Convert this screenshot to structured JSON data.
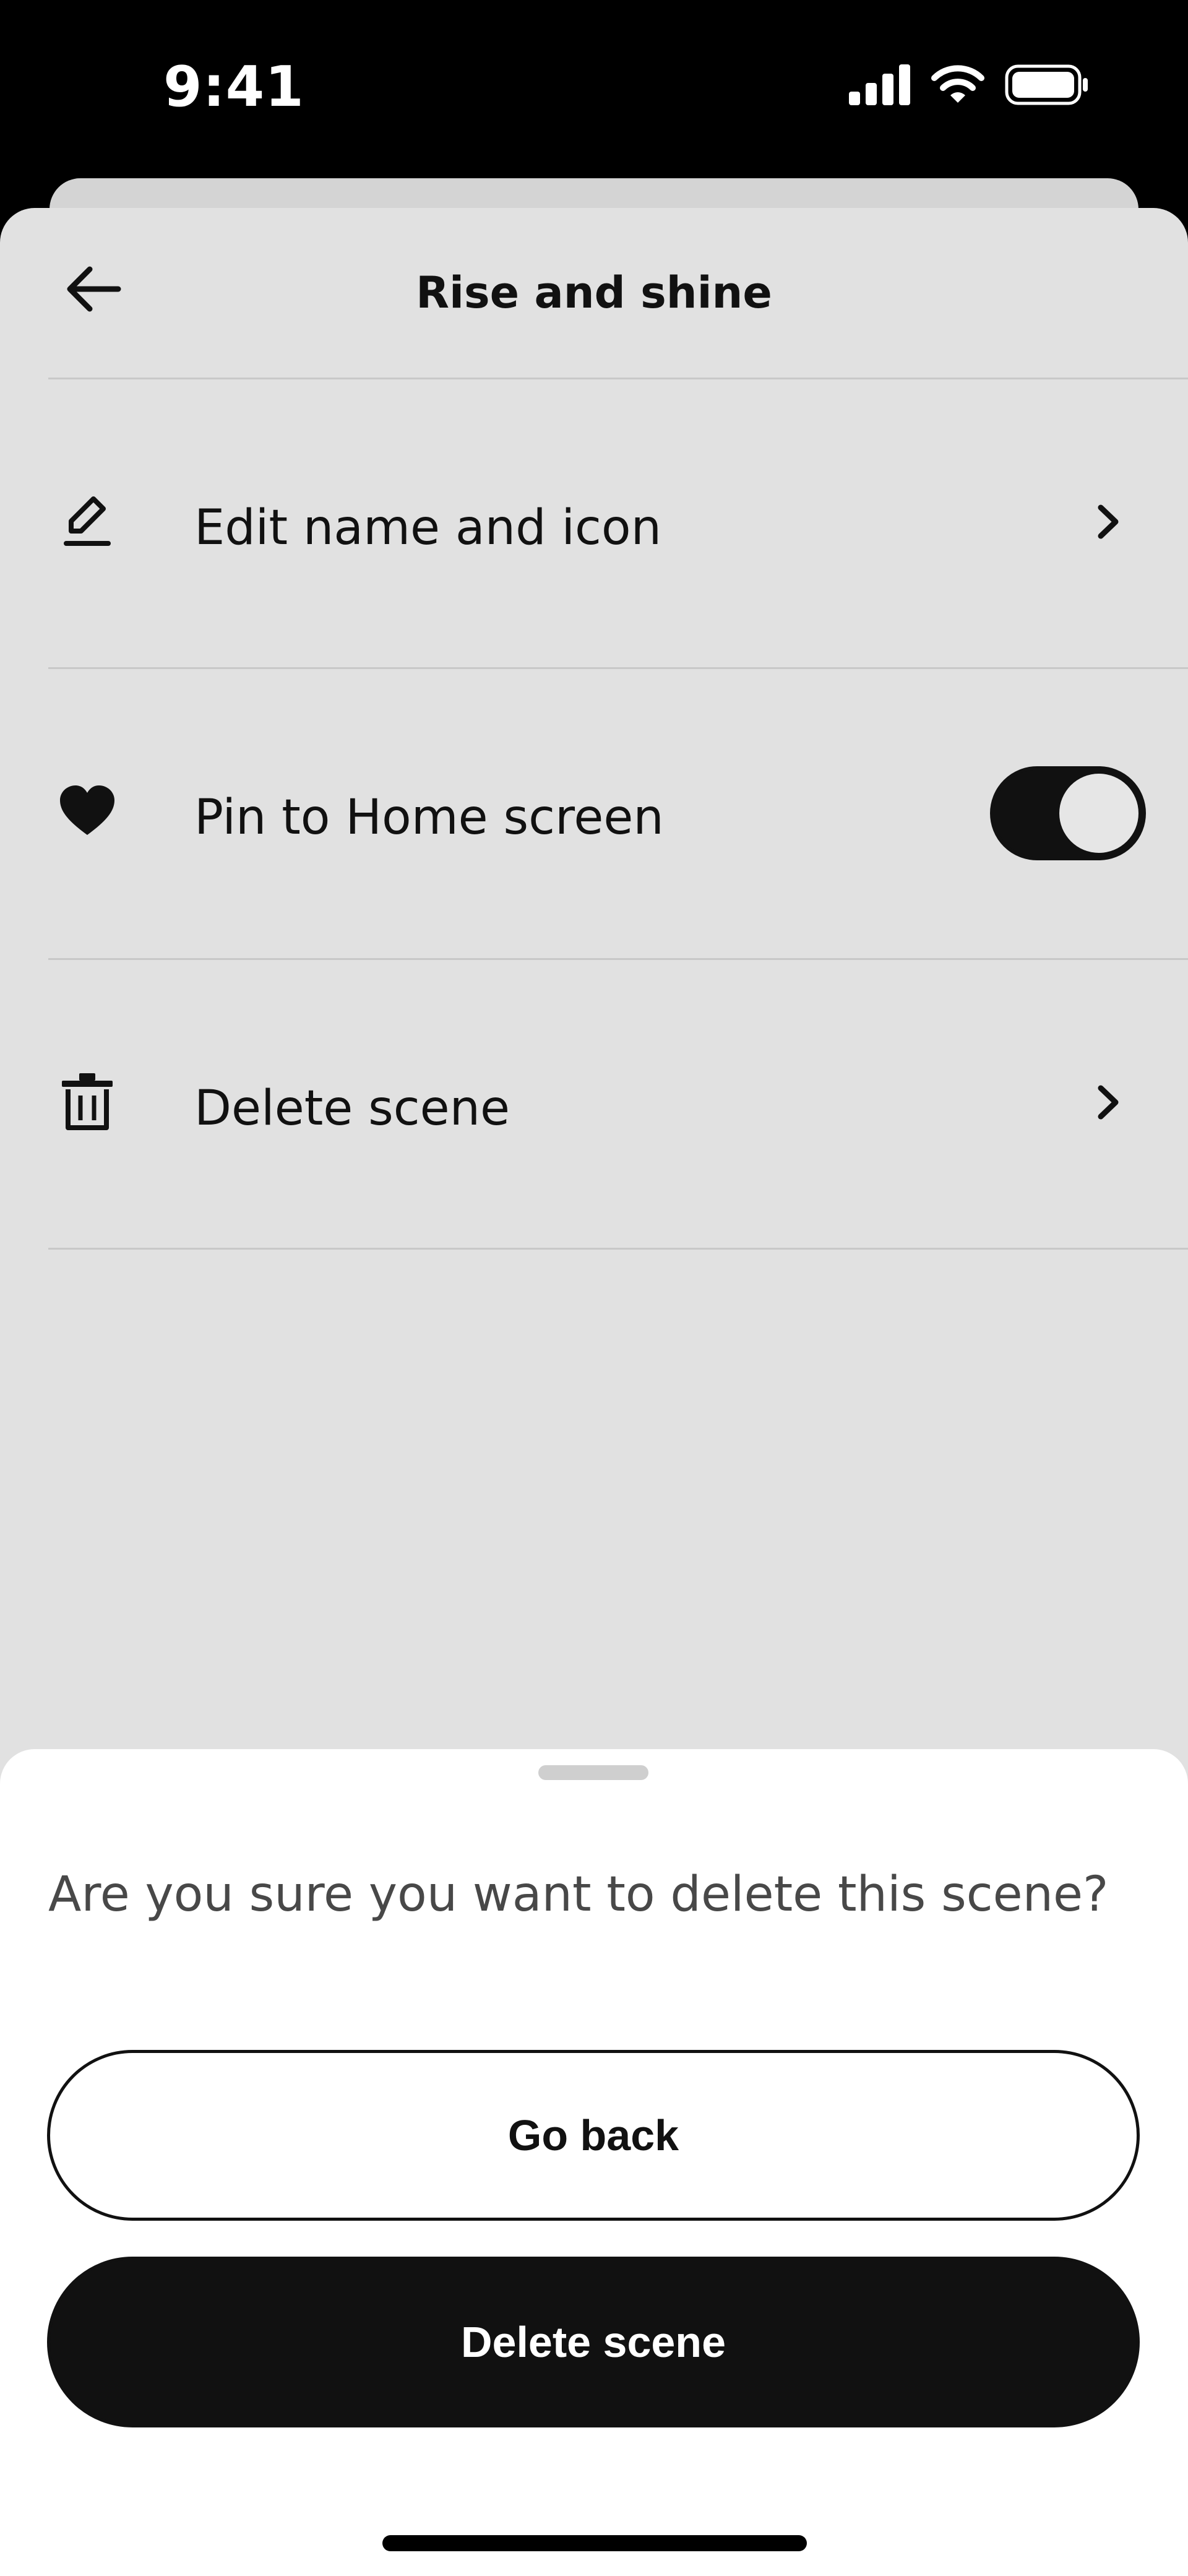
{
  "status_bar": {
    "time": "9:41",
    "icons": [
      "cellular-signal-icon",
      "wifi-icon",
      "battery-icon"
    ]
  },
  "header": {
    "title": "Rise and shine",
    "back_icon": "arrow-left-icon"
  },
  "settings": {
    "items": [
      {
        "label": "Edit name and icon",
        "icon": "pencil-icon",
        "accessory": "chevron-right-icon"
      },
      {
        "label": "Pin to Home screen",
        "icon": "heart-icon",
        "accessory": "toggle",
        "toggle_on": true
      },
      {
        "label": "Delete scene",
        "icon": "trash-icon",
        "accessory": "chevron-right-icon"
      }
    ]
  },
  "dialog": {
    "message": "Are you sure you want to delete this scene?",
    "secondary_label": "Go back",
    "primary_label": "Delete scene"
  },
  "colors": {
    "background": "#000000",
    "sheet": "#e1e1e1",
    "dialog": "#ffffff",
    "primary": "#111111",
    "text": "#111111",
    "muted_text": "#484848"
  }
}
